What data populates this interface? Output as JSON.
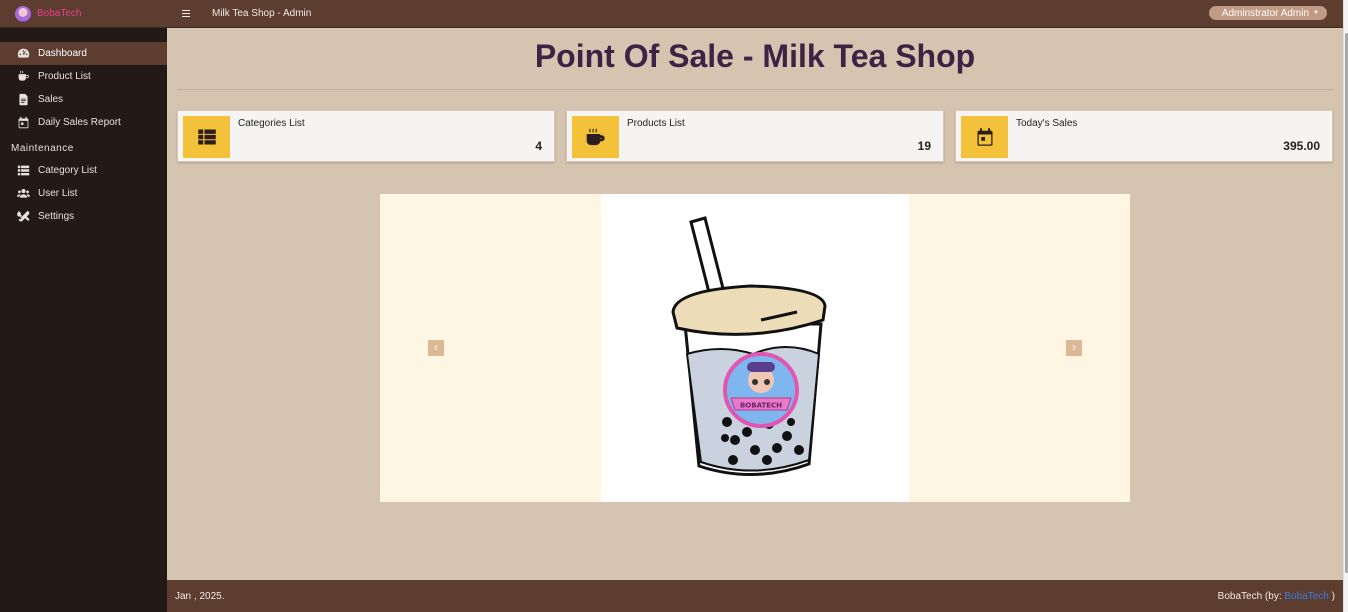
{
  "brand": {
    "name": "BobaTech"
  },
  "topbar": {
    "title": "Milk Tea Shop - Admin",
    "user_label": "Adminstrator Admin"
  },
  "sidebar": {
    "items": [
      {
        "label": "Dashboard",
        "icon": "dashboard-icon",
        "active": true
      },
      {
        "label": "Product List",
        "icon": "coffee-icon"
      },
      {
        "label": "Sales",
        "icon": "receipt-icon"
      },
      {
        "label": "Daily Sales Report",
        "icon": "calendar-icon"
      }
    ],
    "section_header": "Maintenance",
    "maintenance_items": [
      {
        "label": "Category List",
        "icon": "list-icon"
      },
      {
        "label": "User List",
        "icon": "users-icon"
      },
      {
        "label": "Settings",
        "icon": "tools-icon"
      }
    ]
  },
  "main": {
    "title": "Point Of Sale - Milk Tea Shop",
    "cards": [
      {
        "label": "Categories List",
        "value": "4",
        "icon": "th-list-icon"
      },
      {
        "label": "Products List",
        "value": "19",
        "icon": "mug-icon"
      },
      {
        "label": "Today's Sales",
        "value": "395.00",
        "icon": "calendar-icon"
      }
    ],
    "carousel": {
      "logo_text": "BOBATECH",
      "prev_label": "‹",
      "next_label": "›"
    }
  },
  "footer": {
    "date": "Jan , 2025.",
    "credit_prefix": "BobaTech (by:",
    "credit_link": "BobaTech",
    "credit_suffix": ")"
  },
  "colors": {
    "sidebar_bg": "#231a18",
    "topbar_bg": "#5c3d30",
    "content_bg": "#d5c4b0",
    "accent": "#f3c13a",
    "title": "#3d2444",
    "brand": "#e83f8a"
  }
}
